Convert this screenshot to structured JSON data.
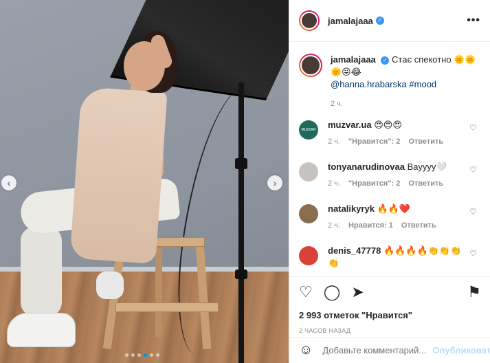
{
  "photo": {
    "prev_arrow": "‹",
    "next_arrow": "›",
    "dots_count": 6,
    "active_dot": 3
  },
  "header": {
    "username": "jamalajaaa",
    "verified_icon": "verified-badge-icon",
    "more_icon": "•••"
  },
  "caption": {
    "username": "jamalajaaa",
    "text": "Стає спекотно 🌞🌞🌞😜😂",
    "mention": "@hanna.hrabarska",
    "hashtag": "#mood",
    "time": "2 ч."
  },
  "comments": [
    {
      "username": "muzvar.ua",
      "text": "😍😍😍",
      "time": "2 ч.",
      "likes": "\"Нравится\": 2",
      "reply": "Ответить",
      "avatar_color": "#1e6b5a",
      "avatar_text": "MUZVAR"
    },
    {
      "username": "tonyanarudinovaa",
      "text": "Вауууу🤍",
      "time": "2 ч.",
      "likes": "\"Нравится\": 2",
      "reply": "Ответить",
      "avatar_color": "#c9c3c0",
      "avatar_text": ""
    },
    {
      "username": "natalikyryk",
      "text": "🔥🔥❤️",
      "time": "2 ч.",
      "likes": "Нравится: 1",
      "reply": "Ответить",
      "avatar_color": "#8a6d4e",
      "avatar_text": ""
    },
    {
      "username": "denis_47778",
      "text": "🔥🔥🔥🔥👏👏👏👏",
      "time": "",
      "likes": "",
      "reply": "",
      "avatar_color": "#d9423a",
      "avatar_text": ""
    }
  ],
  "actions": {
    "like_icon": "♡",
    "comment_icon": "◯",
    "share_icon": "➤",
    "save_icon": "⚑",
    "likes_text": "2 993 отметок \"Нравится\"",
    "posted_ago": "2 ЧАСОВ НАЗАД"
  },
  "add_comment": {
    "emoji_icon": "☺",
    "placeholder": "Добавьте комментарий...",
    "publish_label": "Опубликовать"
  },
  "colors": {
    "link": "#00376b",
    "publish_disabled": "#b2dffc",
    "muted": "#8e8e8e"
  }
}
